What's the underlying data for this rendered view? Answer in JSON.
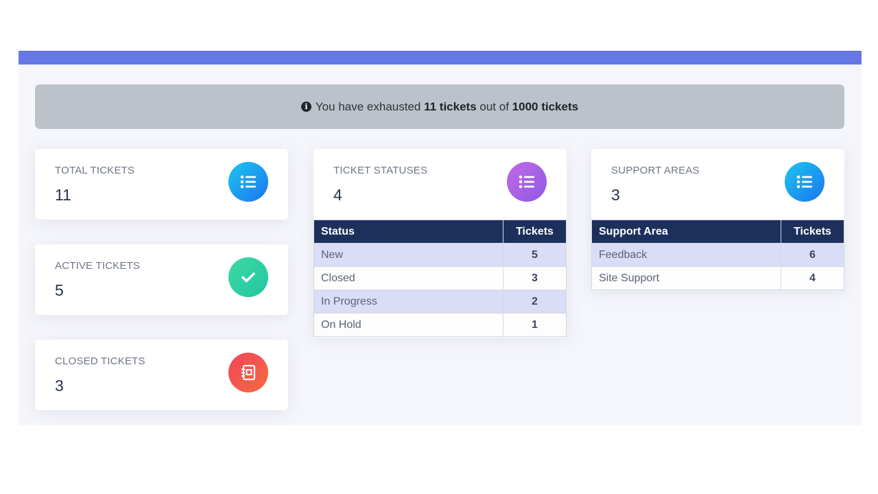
{
  "notice": {
    "prefix": "You have exhausted",
    "used": "11 tickets",
    "middle": "out of",
    "total": "1000 tickets",
    "icon": "info-circle-icon"
  },
  "cards": {
    "total_tickets": {
      "title": "TOTAL TICKETS",
      "value": "11",
      "icon": "list-icon"
    },
    "active_tickets": {
      "title": "ACTIVE TICKETS",
      "value": "5",
      "icon": "check-icon"
    },
    "closed_tickets": {
      "title": "CLOSED TICKETS",
      "value": "3",
      "icon": "notebook-icon"
    },
    "ticket_statuses": {
      "title": "TICKET STATUSES",
      "value": "4",
      "icon": "list-icon"
    },
    "support_areas": {
      "title": "SUPPORT AREAS",
      "value": "3",
      "icon": "list-icon"
    }
  },
  "status_table": {
    "headers": [
      "Status",
      "Tickets"
    ],
    "rows": [
      {
        "label": "New",
        "count": "5"
      },
      {
        "label": "Closed",
        "count": "3"
      },
      {
        "label": "In Progress",
        "count": "2"
      },
      {
        "label": "On Hold",
        "count": "1"
      }
    ]
  },
  "area_table": {
    "headers": [
      "Support Area",
      "Tickets"
    ],
    "rows": [
      {
        "label": "Feedback",
        "count": "6"
      },
      {
        "label": "Site Support",
        "count": "4"
      }
    ]
  },
  "colors": {
    "topbar": "#6578e4",
    "table_header": "#1d305c",
    "row_highlight": "#d9ddf7"
  }
}
